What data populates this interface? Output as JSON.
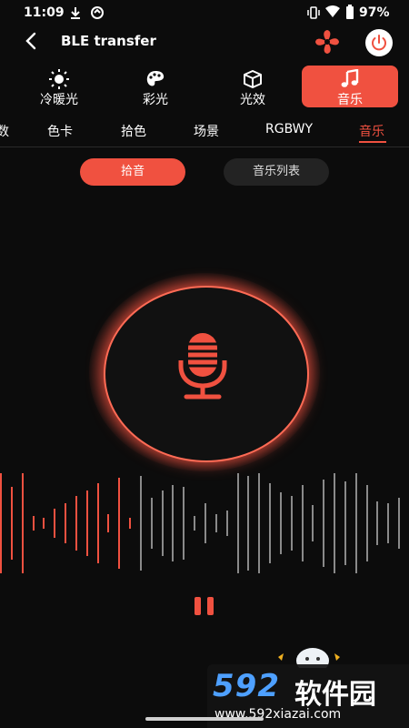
{
  "status_bar": {
    "time": "11:09",
    "battery": "97%"
  },
  "app_bar": {
    "title": "BLE transfer"
  },
  "mode_tabs": [
    {
      "label": "冷暖光",
      "icon": "sun-icon"
    },
    {
      "label": "彩光",
      "icon": "palette-icon"
    },
    {
      "label": "光效",
      "icon": "cube-icon"
    },
    {
      "label": "音乐",
      "icon": "music-note-icon",
      "active": true
    }
  ],
  "sub_tabs": [
    {
      "label": "数"
    },
    {
      "label": "色卡"
    },
    {
      "label": "拾色"
    },
    {
      "label": "场景"
    },
    {
      "label": "RGBWY"
    },
    {
      "label": "音乐",
      "active": true
    }
  ],
  "buttons": {
    "pickup": "拾音",
    "music_list": "音乐列表"
  },
  "waveform": {
    "bars": [
      56,
      40,
      60,
      8,
      6,
      16,
      22,
      30,
      36,
      44,
      10,
      50,
      6,
      52,
      28,
      36,
      42,
      40,
      8,
      22,
      10,
      14,
      56,
      52,
      58,
      44,
      34,
      30,
      42,
      20,
      48,
      62,
      46,
      56,
      42,
      24,
      22,
      28
    ]
  },
  "watermark": {
    "brand": "592",
    "brand2": "软件园",
    "url": "www.592xiazai.com"
  },
  "colors": {
    "accent": "#f05140",
    "background": "#0c0c0c",
    "watermark_blue": "#4ea0ff"
  }
}
